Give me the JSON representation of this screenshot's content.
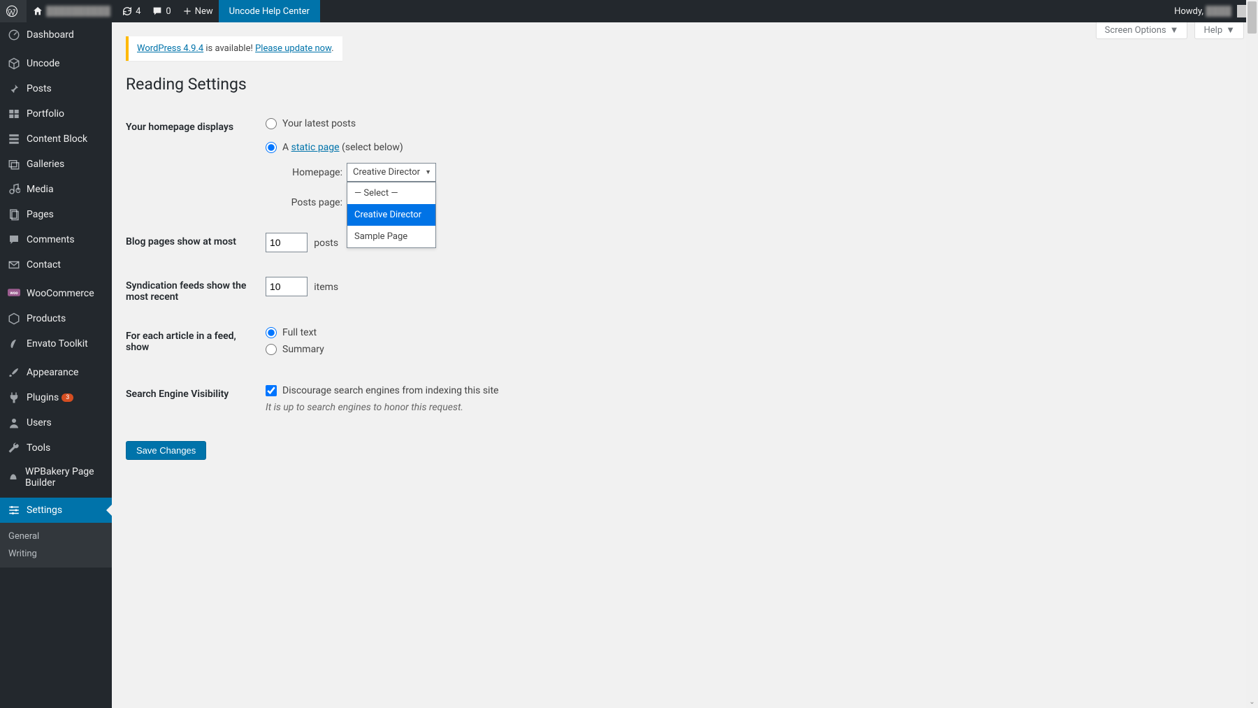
{
  "adminbar": {
    "site_name_blur": "██████████",
    "updates_count": "4",
    "comments_count": "0",
    "new_label": "New",
    "help_center": "Uncode Help Center",
    "greeting": "Howdy,",
    "user_name_blur": "████"
  },
  "sidebar": {
    "items": [
      {
        "label": "Dashboard",
        "icon": "dashboard"
      },
      {
        "label": "Uncode",
        "icon": "box"
      },
      {
        "label": "Posts",
        "icon": "pin"
      },
      {
        "label": "Portfolio",
        "icon": "portfolio"
      },
      {
        "label": "Content Block",
        "icon": "blocks"
      },
      {
        "label": "Galleries",
        "icon": "gallery"
      },
      {
        "label": "Media",
        "icon": "media"
      },
      {
        "label": "Pages",
        "icon": "pages"
      },
      {
        "label": "Comments",
        "icon": "comment"
      },
      {
        "label": "Contact",
        "icon": "mail"
      },
      {
        "label": "WooCommerce",
        "icon": "woo"
      },
      {
        "label": "Products",
        "icon": "products"
      },
      {
        "label": "Envato Toolkit",
        "icon": "envato"
      },
      {
        "label": "Appearance",
        "icon": "brush"
      },
      {
        "label": "Plugins",
        "icon": "plug",
        "badge": "3"
      },
      {
        "label": "Users",
        "icon": "user"
      },
      {
        "label": "Tools",
        "icon": "wrench"
      },
      {
        "label": "WPBakery Page Builder",
        "icon": "wpb"
      },
      {
        "label": "Settings",
        "icon": "settings",
        "current": true
      }
    ],
    "submenu": [
      "General",
      "Writing"
    ]
  },
  "screen_meta": {
    "screen_options": "Screen Options",
    "help": "Help"
  },
  "notice": {
    "link1": "WordPress 4.9.4",
    "text_mid": " is available! ",
    "link2": "Please update now",
    "tail": "."
  },
  "page_title": "Reading Settings",
  "form": {
    "homepage_displays_label": "Your homepage displays",
    "opt_latest": "Your latest posts",
    "opt_static_prefix": "A ",
    "opt_static_link": "static page",
    "opt_static_suffix": " (select below)",
    "homepage_label": "Homepage:",
    "homepage_value": "Creative Director",
    "homepage_options": [
      "— Select —",
      "Creative Director",
      "Sample Page"
    ],
    "posts_page_label": "Posts page:",
    "blog_pages_label": "Blog pages show at most",
    "blog_pages_value": "10",
    "blog_pages_suffix": "posts",
    "syndication_label": "Syndication feeds show the most recent",
    "syndication_value": "10",
    "syndication_suffix": "items",
    "feed_article_label": "For each article in a feed, show",
    "feed_full": "Full text",
    "feed_summary": "Summary",
    "seo_visibility_label": "Search Engine Visibility",
    "seo_checkbox": "Discourage search engines from indexing this site",
    "seo_desc": "It is up to search engines to honor this request.",
    "save": "Save Changes"
  }
}
